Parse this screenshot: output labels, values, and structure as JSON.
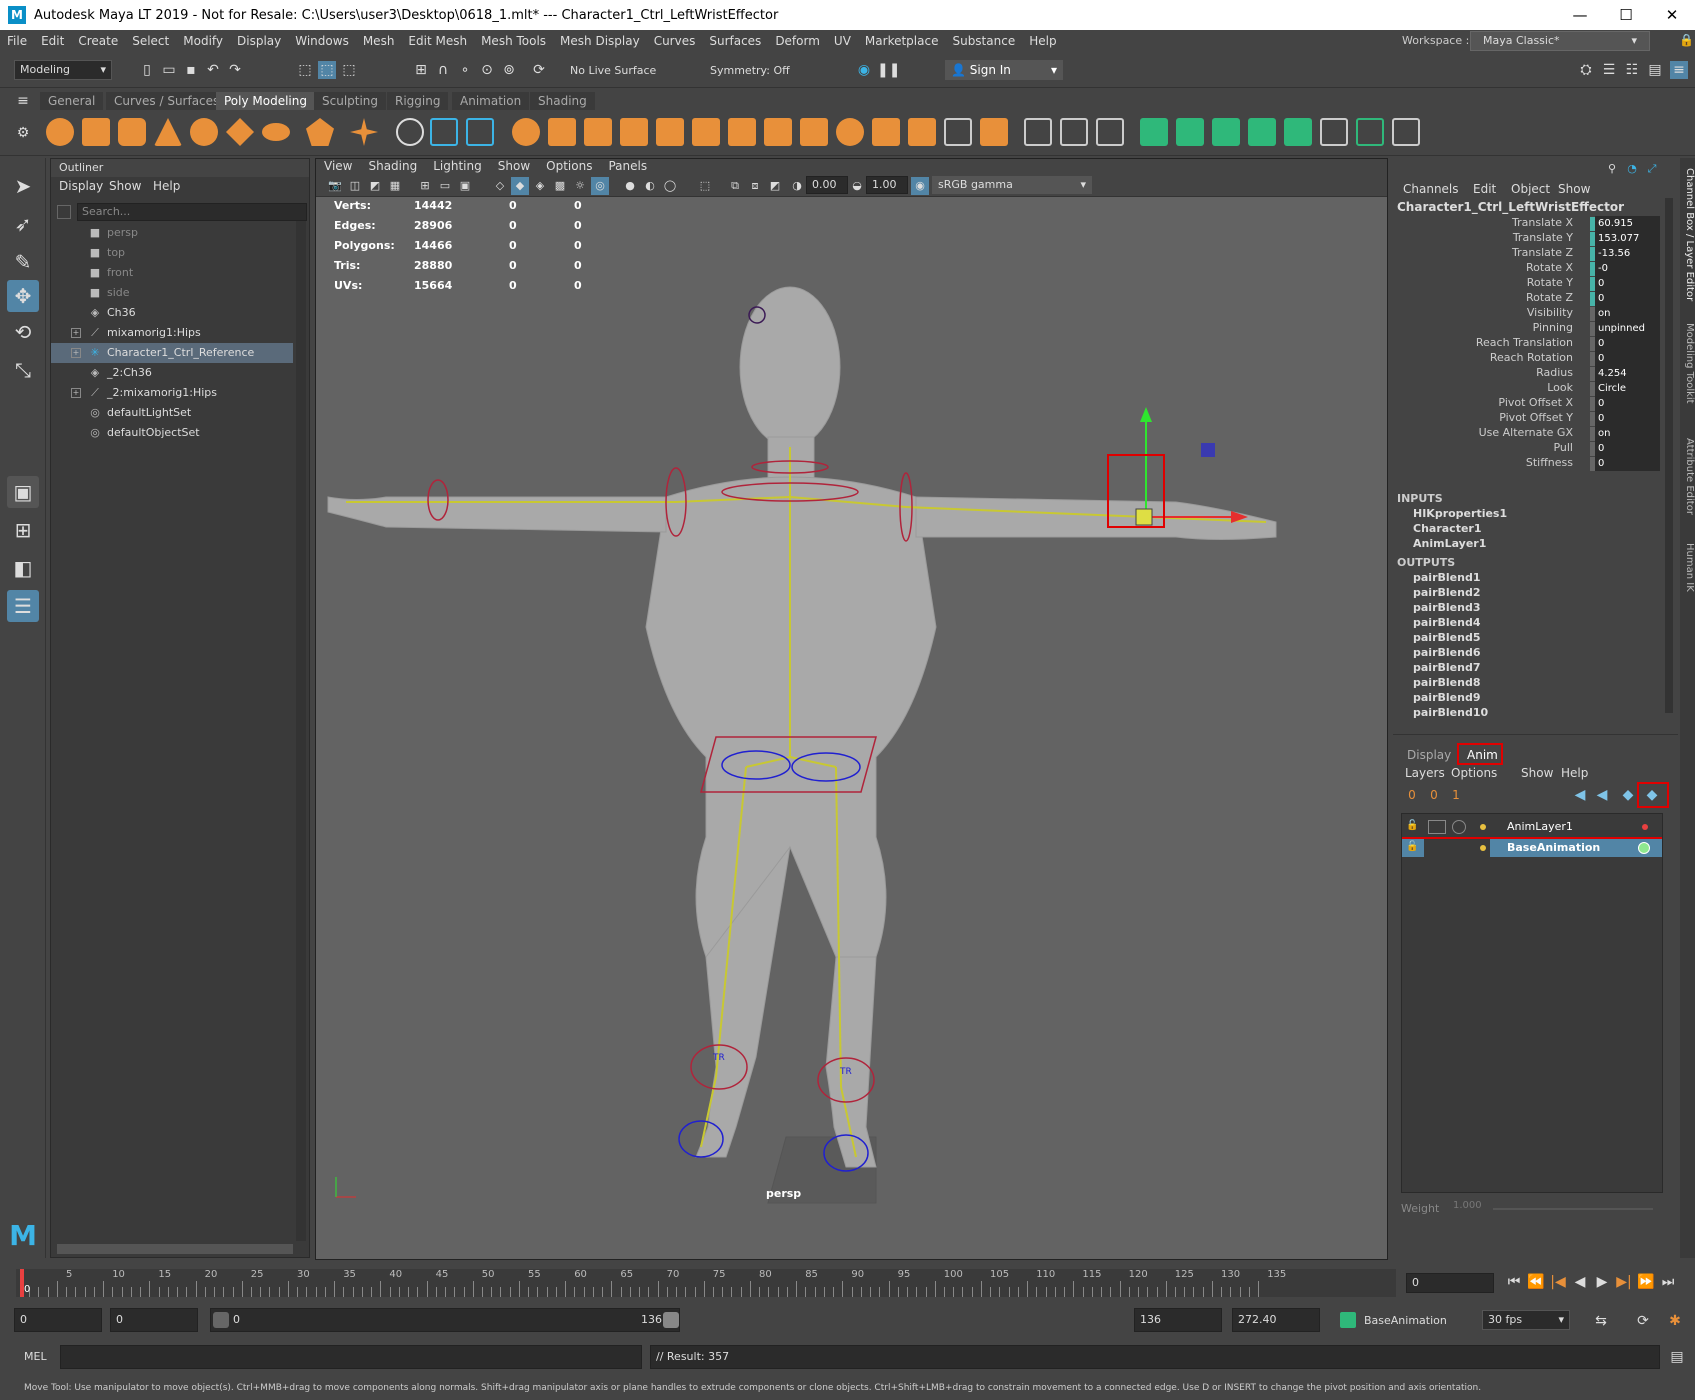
{
  "window": {
    "title": "Autodesk Maya LT 2019 - Not for Resale: C:\\Users\\user3\\Desktop\\0618_1.mlt*   ---   Character1_Ctrl_LeftWristEffector",
    "logo": "M"
  },
  "menu": [
    "File",
    "Edit",
    "Create",
    "Select",
    "Modify",
    "Display",
    "Windows",
    "Mesh",
    "Edit Mesh",
    "Mesh Tools",
    "Mesh Display",
    "Curves",
    "Surfaces",
    "Deform",
    "UV",
    "Marketplace",
    "Substance",
    "Help"
  ],
  "workspace": {
    "label": "Workspace :",
    "value": "Maya Classic*"
  },
  "statusline": {
    "mode": "Modeling",
    "live_surface": "No Live Surface",
    "symmetry": "Symmetry: Off",
    "sign_in": "Sign In"
  },
  "shelf_tabs": [
    "General",
    "Curves / Surfaces",
    "Poly Modeling",
    "Sculpting",
    "Rigging",
    "Animation",
    "Shading"
  ],
  "shelf_active": "Poly Modeling",
  "outliner": {
    "title": "Outliner",
    "menu": [
      "Display",
      "Show",
      "Help"
    ],
    "search_placeholder": "Search...",
    "items": [
      {
        "label": "persp",
        "icon": "camera-icon",
        "dim": true,
        "expand": false
      },
      {
        "label": "top",
        "icon": "camera-icon",
        "dim": true,
        "expand": false
      },
      {
        "label": "front",
        "icon": "camera-icon",
        "dim": true,
        "expand": false
      },
      {
        "label": "side",
        "icon": "camera-icon",
        "dim": true,
        "expand": false
      },
      {
        "label": "Ch36",
        "icon": "mesh-icon",
        "dim": false,
        "expand": false
      },
      {
        "label": "mixamorig1:Hips",
        "icon": "joint-icon",
        "dim": false,
        "expand": true
      },
      {
        "label": "Character1_Ctrl_Reference",
        "icon": "hik-icon",
        "dim": false,
        "expand": true,
        "selected": true
      },
      {
        "label": "_2:Ch36",
        "icon": "mesh-icon",
        "dim": false,
        "expand": false
      },
      {
        "label": "_2:mixamorig1:Hips",
        "icon": "joint-icon",
        "dim": false,
        "expand": true
      },
      {
        "label": "defaultLightSet",
        "icon": "set-icon",
        "dim": false,
        "expand": false
      },
      {
        "label": "defaultObjectSet",
        "icon": "set-icon",
        "dim": false,
        "expand": false
      }
    ]
  },
  "viewport": {
    "menu": [
      "View",
      "Shading",
      "Lighting",
      "Show",
      "Options",
      "Panels"
    ],
    "exposure": "0.00",
    "gamma": "1.00",
    "colorspace": "sRGB gamma",
    "camera": "persp",
    "hud": [
      {
        "label": "Verts:",
        "v": "14442",
        "a": "0",
        "b": "0"
      },
      {
        "label": "Edges:",
        "v": "28906",
        "a": "0",
        "b": "0"
      },
      {
        "label": "Polygons:",
        "v": "14466",
        "a": "0",
        "b": "0"
      },
      {
        "label": "Tris:",
        "v": "28880",
        "a": "0",
        "b": "0"
      },
      {
        "label": "UVs:",
        "v": "15664",
        "a": "0",
        "b": "0"
      }
    ],
    "tr_labels": [
      "TR",
      "TR"
    ]
  },
  "channelbox": {
    "menu": [
      "Channels",
      "Edit",
      "Object",
      "Show"
    ],
    "object": "Character1_Ctrl_LeftWristEffector",
    "channels": [
      {
        "name": "Translate X",
        "value": "60.915",
        "keyed": true
      },
      {
        "name": "Translate Y",
        "value": "153.077",
        "keyed": true
      },
      {
        "name": "Translate Z",
        "value": "-13.56",
        "keyed": true
      },
      {
        "name": "Rotate X",
        "value": "-0",
        "keyed": true
      },
      {
        "name": "Rotate Y",
        "value": "0",
        "keyed": true
      },
      {
        "name": "Rotate Z",
        "value": "0",
        "keyed": true
      },
      {
        "name": "Visibility",
        "value": "on",
        "keyed": false
      },
      {
        "name": "Pinning",
        "value": "unpinned",
        "keyed": false
      },
      {
        "name": "Reach Translation",
        "value": "0",
        "keyed": false
      },
      {
        "name": "Reach Rotation",
        "value": "0",
        "keyed": false
      },
      {
        "name": "Radius",
        "value": "4.254",
        "keyed": false
      },
      {
        "name": "Look",
        "value": "Circle",
        "keyed": false
      },
      {
        "name": "Pivot Offset X",
        "value": "0",
        "keyed": false
      },
      {
        "name": "Pivot Offset Y",
        "value": "0",
        "keyed": false
      },
      {
        "name": "Use Alternate GX",
        "value": "on",
        "keyed": false
      },
      {
        "name": "Pull",
        "value": "0",
        "keyed": false
      },
      {
        "name": "Stiffness",
        "value": "0",
        "keyed": false
      }
    ],
    "inputs_label": "INPUTS",
    "inputs": [
      "HIKproperties1",
      "Character1",
      "AnimLayer1"
    ],
    "outputs_label": "OUTPUTS",
    "outputs": [
      "pairBlend1",
      "pairBlend2",
      "pairBlend3",
      "pairBlend4",
      "pairBlend5",
      "pairBlend6",
      "pairBlend7",
      "pairBlend8",
      "pairBlend9",
      "pairBlend10"
    ]
  },
  "layer_editor": {
    "tabs": [
      "Display",
      "Anim"
    ],
    "active_tab": "Anim",
    "menu": [
      "Layers",
      "Options",
      "Show",
      "Help"
    ],
    "layers": [
      {
        "name": "AnimLayer1",
        "selected": false
      },
      {
        "name": "BaseAnimation",
        "selected": true
      }
    ],
    "weight_label": "Weight",
    "weight_value": "1.000"
  },
  "side_tabs": [
    "Channel Box / Layer Editor",
    "Modeling Toolkit",
    "Attribute Editor",
    "Human IK"
  ],
  "timeline": {
    "ticks": [
      "5",
      "10",
      "15",
      "20",
      "25",
      "30",
      "35",
      "40",
      "45",
      "50",
      "55",
      "60",
      "65",
      "70",
      "75",
      "80",
      "85",
      "90",
      "95",
      "100",
      "105",
      "110",
      "115",
      "120",
      "125",
      "130",
      "135"
    ],
    "current_frame": "0",
    "frame_field": "0"
  },
  "range": {
    "start": "0",
    "playback_start": "0",
    "slider_start": "0",
    "slider_end": "136",
    "playback_end": "136",
    "end": "272.40",
    "anim_layer": "BaseAnimation",
    "fps": "30 fps"
  },
  "command": {
    "lang": "MEL",
    "result": "// Result: 357"
  },
  "help": "Move Tool: Use manipulator to move object(s). Ctrl+MMB+drag to move components along normals. Shift+drag manipulator axis or plane handles to extrude components or clone objects. Ctrl+Shift+LMB+drag to constrain movement to a connected edge. Use D or INSERT to change the pivot position and axis orientation.",
  "colors": {
    "accent_red": "#e00000",
    "selection_blue": "#5285a6",
    "key_teal": "#47b3a8",
    "rig_yellow": "#c8c832",
    "shelf_orange": "#e8903a",
    "shelf_green": "#2fb87a"
  }
}
